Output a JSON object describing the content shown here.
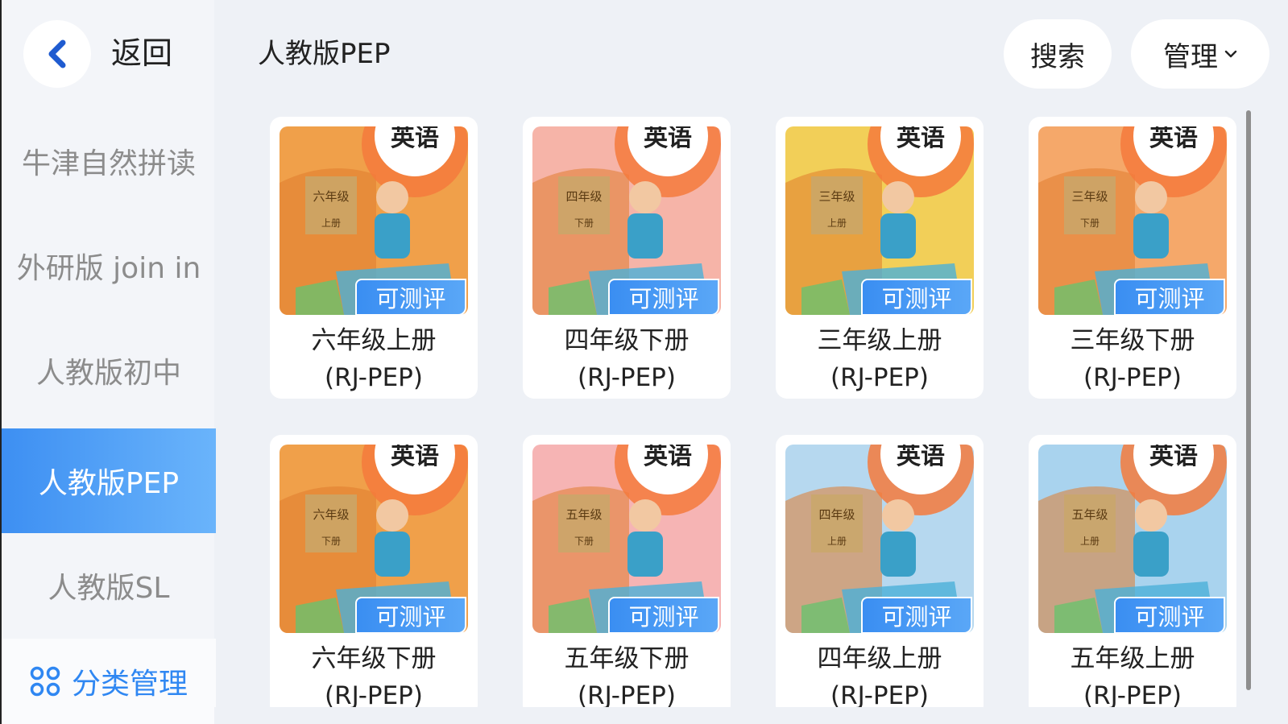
{
  "sidebar": {
    "back_label": "返回",
    "categories": [
      {
        "label": "牛津自然拼读",
        "active": false
      },
      {
        "label": "外研版 join in",
        "active": false
      },
      {
        "label": "人教版初中",
        "active": false
      },
      {
        "label": "人教版PEP",
        "active": true
      },
      {
        "label": "人教版SL",
        "active": false
      }
    ],
    "manage_label": "分类管理"
  },
  "header": {
    "title": "人教版PEP",
    "search_label": "搜索",
    "manage_label": "管理"
  },
  "colors": {
    "accent": "#3d8ff2",
    "manage_text": "#2f87f2"
  },
  "books": [
    {
      "name": "六年级上册",
      "edition": "(RJ-PEP)",
      "badge": "可测评",
      "cover_grade": "六年级",
      "cover_volume": "上册",
      "cover_subject": "英语",
      "bg": "#f0a04a"
    },
    {
      "name": "四年级下册",
      "edition": "(RJ-PEP)",
      "badge": "可测评",
      "cover_grade": "四年级",
      "cover_volume": "下册",
      "cover_subject": "英语",
      "bg": "#f6b4a8"
    },
    {
      "name": "三年级上册",
      "edition": "(RJ-PEP)",
      "badge": "可测评",
      "cover_grade": "三年级",
      "cover_volume": "上册",
      "cover_subject": "英语",
      "bg": "#f2cf58"
    },
    {
      "name": "三年级下册",
      "edition": "(RJ-PEP)",
      "badge": "可测评",
      "cover_grade": "三年级",
      "cover_volume": "下册",
      "cover_subject": "英语",
      "bg": "#f5a86a"
    },
    {
      "name": "六年级下册",
      "edition": "(RJ-PEP)",
      "badge": "可测评",
      "cover_grade": "六年级",
      "cover_volume": "下册",
      "cover_subject": "英语",
      "bg": "#f0a04a"
    },
    {
      "name": "五年级下册",
      "edition": "(RJ-PEP)",
      "badge": "可测评",
      "cover_grade": "五年级",
      "cover_volume": "下册",
      "cover_subject": "英语",
      "bg": "#f6b4b4"
    },
    {
      "name": "四年级上册",
      "edition": "(RJ-PEP)",
      "badge": "可测评",
      "cover_grade": "四年级",
      "cover_volume": "上册",
      "cover_subject": "英语",
      "bg": "#b6d8ef"
    },
    {
      "name": "五年级上册",
      "edition": "(RJ-PEP)",
      "badge": "可测评",
      "cover_grade": "五年级",
      "cover_volume": "上册",
      "cover_subject": "英语",
      "bg": "#a9d3ee"
    }
  ]
}
